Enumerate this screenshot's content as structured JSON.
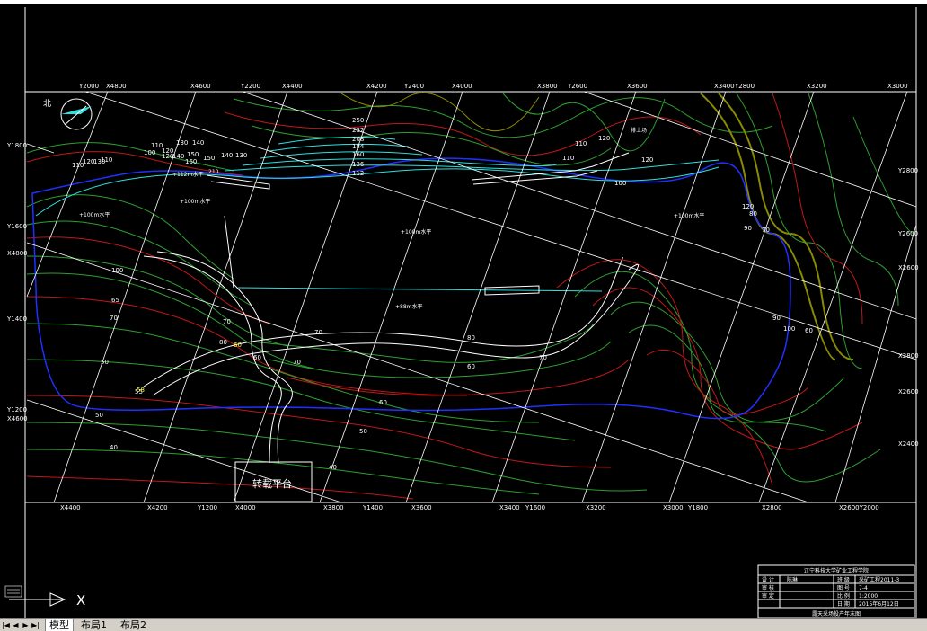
{
  "grid_labels_top": [
    "Y2000",
    "X4800",
    "X4600",
    "Y2200",
    "X4400",
    "X4200",
    "Y2400",
    "X4000",
    "X3800",
    "Y2600",
    "X3600",
    "X3400",
    "Y2800",
    "X3200",
    "X3000"
  ],
  "grid_labels_bottom": [
    "X4400",
    "X4200",
    "Y1200",
    "X4000",
    "X3800",
    "Y1400",
    "X3600",
    "X3400",
    "Y1600",
    "X3200",
    "X3000",
    "Y1800",
    "X2800",
    "X2600Y2000"
  ],
  "grid_labels_left": [
    "Y1800",
    "Y1600",
    "X4800",
    "Y1400",
    "Y1200",
    "X4600"
  ],
  "grid_labels_right": [
    "Y2800",
    "Y2600",
    "X2600",
    "X2800",
    "X2600",
    "X2400"
  ],
  "north_label": "北",
  "bench_labels": [
    "250",
    "232",
    "208",
    "184",
    "160",
    "136",
    "112"
  ],
  "contour_labels_top": [
    "110",
    "120",
    "130",
    "140",
    "150",
    "100",
    "120",
    "140",
    "160",
    "140",
    "130",
    "110",
    "120",
    "130",
    "110",
    "150",
    "110",
    "120",
    "110",
    "100",
    "120",
    "120"
  ],
  "contour_labels_mid": [
    "100",
    "65",
    "70",
    "50",
    "55",
    "50",
    "40",
    "50",
    "40",
    "70",
    "60",
    "60",
    "70",
    "80",
    "70",
    "60",
    "60",
    "70",
    "80",
    "90",
    "100",
    "90",
    "80",
    "70",
    "60",
    "58"
  ],
  "level_labels": [
    "+112m水平",
    "+100m水平",
    "+100m水平",
    "+100m水平",
    "+100m水平",
    "+88m水平",
    "210",
    "排土场"
  ],
  "loading_platform": "转载平台",
  "title_block": {
    "header": "辽宁科技大学矿业工程学院",
    "rows": [
      [
        "设 计",
        "陈琳",
        "班 级",
        "采矿工程2011-3"
      ],
      [
        "审 核",
        "",
        "图 号",
        "7-4"
      ],
      [
        "审 定",
        "",
        "比 例",
        "1:2000"
      ],
      [
        "",
        "",
        "日 期",
        "2015年6月12日"
      ]
    ],
    "footer": "露天采场投产年末图"
  },
  "ucs_label": "X",
  "tabs": {
    "model": "模型",
    "layout1": "布局1",
    "layout2": "布局2"
  },
  "nav_buttons": [
    "|◀",
    "◀",
    "▶",
    "▶|"
  ]
}
